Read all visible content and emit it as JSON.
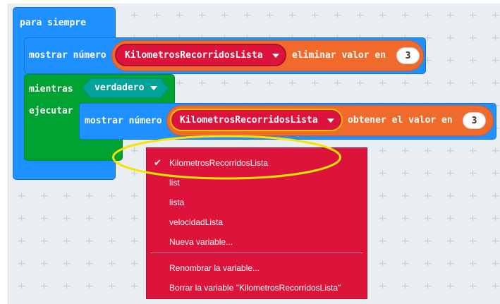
{
  "blocks": {
    "forever_label": "para siempre",
    "show_number_label_1": "mostrar número",
    "list_var_1": "KilometrosRecorridosLista",
    "remove_label": "eliminar valor en",
    "remove_index": "3",
    "while_label": "mientras",
    "while_condition": "verdadero",
    "do_label": "ejecutar",
    "show_number_label_2": "mostrar número",
    "list_var_2": "KilometrosRecorridosLista",
    "get_label": "obtener el valor en",
    "get_index": "3"
  },
  "dropdown": {
    "selected_check": "✔",
    "items": [
      "KilometrosRecorridosLista",
      "list",
      "lista",
      "velocidadLista",
      "Nueva variable..."
    ],
    "actions": [
      "Renombrar la variable...",
      "Borrar la variable \"KilometrosRecorridosLista\""
    ]
  },
  "colors": {
    "loops_blue": "#1e90ff",
    "logic_green": "#00a231",
    "boolean_teal": "#00a29a",
    "arrays_orange": "#f06a2c",
    "variable_red": "#dc143c",
    "highlight_yellow": "#f5e500"
  }
}
